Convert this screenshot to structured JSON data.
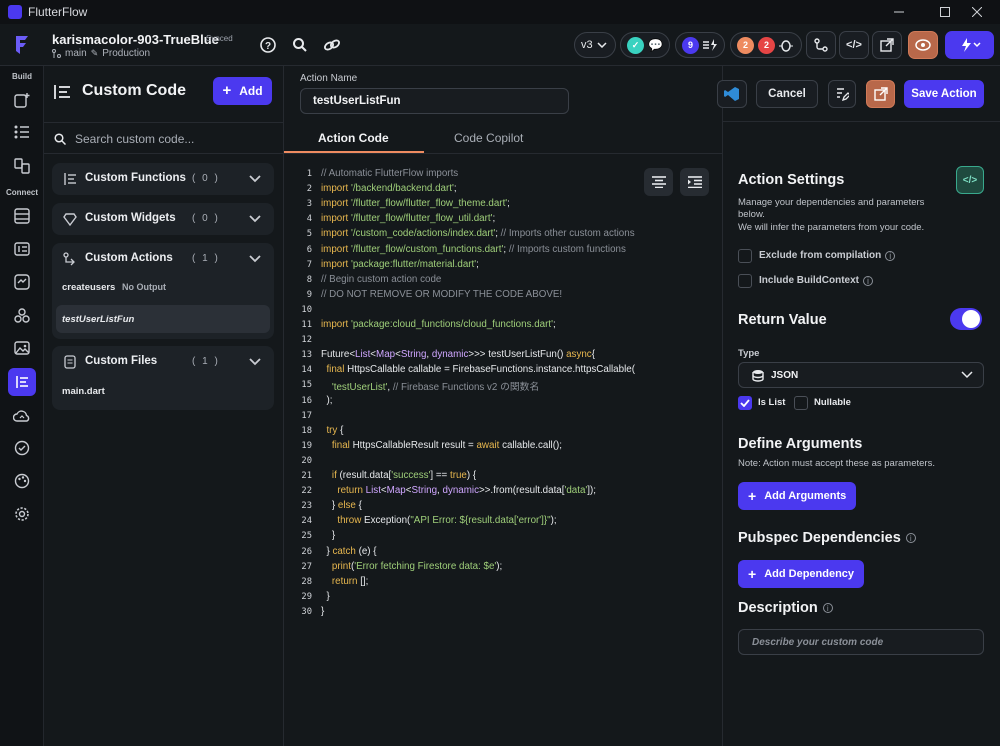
{
  "window": {
    "title": "FlutterFlow"
  },
  "header": {
    "project": "karismacolor-903-TrueBlue",
    "sync_status": "Synced",
    "branch": "main",
    "environment": "Production",
    "version": "v3",
    "badge_purple": "9",
    "badge_orange": "2",
    "badge_red": "2"
  },
  "rail": {
    "build_label": "Build",
    "connect_label": "Connect"
  },
  "left": {
    "title": "Custom Code",
    "add_label": "Add",
    "search_placeholder": "Search custom code...",
    "sections": [
      {
        "label": "Custom Functions",
        "count": "( 0 )"
      },
      {
        "label": "Custom Widgets",
        "count": "( 0 )"
      },
      {
        "label": "Custom Actions",
        "count": "( 1 )"
      },
      {
        "label": "Custom Files",
        "count": "( 1 )"
      }
    ],
    "actions": [
      {
        "name": "createusers",
        "note": "No Output"
      },
      {
        "name": "testUserListFun"
      }
    ],
    "files": [
      "main.dart"
    ]
  },
  "editor": {
    "action_name_label": "Action Name",
    "action_name": "testUserListFun",
    "tabs": [
      "Action Code",
      "Code Copilot"
    ],
    "lines": [
      [
        [
          "c-com",
          "// Automatic FlutterFlow imports"
        ]
      ],
      [
        [
          "c-kw",
          "import "
        ],
        [
          "c-str",
          "'/backend/backend.dart'"
        ],
        [
          "",
          "; "
        ]
      ],
      [
        [
          "c-kw",
          "import "
        ],
        [
          "c-str",
          "'/flutter_flow/flutter_flow_theme.dart'"
        ],
        [
          "",
          ";"
        ]
      ],
      [
        [
          "c-kw",
          "import "
        ],
        [
          "c-str",
          "'/flutter_flow/flutter_flow_util.dart'"
        ],
        [
          "",
          ";"
        ]
      ],
      [
        [
          "c-kw",
          "import "
        ],
        [
          "c-str",
          "'/custom_code/actions/index.dart'"
        ],
        [
          "",
          "; "
        ],
        [
          "c-com",
          "// Imports other custom actions"
        ]
      ],
      [
        [
          "c-kw",
          "import "
        ],
        [
          "c-str",
          "'/flutter_flow/custom_functions.dart'"
        ],
        [
          "",
          "; "
        ],
        [
          "c-com",
          "// Imports custom functions"
        ]
      ],
      [
        [
          "c-kw",
          "import "
        ],
        [
          "c-str",
          "'package:flutter/material.dart'"
        ],
        [
          "",
          ";"
        ]
      ],
      [
        [
          "c-com",
          "// Begin custom action code"
        ]
      ],
      [
        [
          "c-com",
          "// DO NOT REMOVE OR MODIFY THE CODE ABOVE!"
        ]
      ],
      [
        [
          "",
          ""
        ]
      ],
      [
        [
          "c-kw",
          "import "
        ],
        [
          "c-str",
          "'package:cloud_functions/cloud_functions.dart'"
        ],
        [
          "",
          ";"
        ]
      ],
      [
        [
          "",
          ""
        ]
      ],
      [
        [
          "",
          "Future<"
        ],
        [
          "c-ty",
          "List"
        ],
        [
          "",
          "<"
        ],
        [
          "c-ty",
          "Map"
        ],
        [
          "",
          "<"
        ],
        [
          "c-ty",
          "String"
        ],
        [
          "",
          ", "
        ],
        [
          "c-ty",
          "dynamic"
        ],
        [
          "",
          ">>> testUserListFun() "
        ],
        [
          "c-kw",
          "async"
        ],
        [
          "",
          ""
        ],
        [
          "",
          "{"
        ]
      ],
      [
        [
          "",
          "  "
        ],
        [
          "c-kw",
          "final"
        ],
        [
          "",
          " HttpsCallable callable = FirebaseFunctions.instance.httpsCallable("
        ]
      ],
      [
        [
          "",
          "    "
        ],
        [
          "c-str",
          "'testUserList'"
        ],
        [
          "",
          ", "
        ],
        [
          "c-com",
          "// Firebase Functions v2 の関数名"
        ]
      ],
      [
        [
          "",
          "  );"
        ]
      ],
      [
        [
          "",
          ""
        ]
      ],
      [
        [
          "",
          "  "
        ],
        [
          "c-kw",
          "try"
        ],
        [
          "",
          " {"
        ]
      ],
      [
        [
          "",
          "    "
        ],
        [
          "c-kw",
          "final"
        ],
        [
          "",
          " HttpsCallableResult result = "
        ],
        [
          "c-kw",
          "await"
        ],
        [
          "",
          " callable.call();"
        ]
      ],
      [
        [
          "",
          ""
        ]
      ],
      [
        [
          "",
          "    "
        ],
        [
          "c-kw",
          "if"
        ],
        [
          "",
          " (result.data["
        ],
        [
          "c-str",
          "'success'"
        ],
        [
          "",
          "] == "
        ],
        [
          "c-kw",
          "true"
        ],
        [
          "",
          ") {"
        ]
      ],
      [
        [
          "",
          "      "
        ],
        [
          "c-kw",
          "return"
        ],
        [
          "",
          " "
        ],
        [
          "c-ty",
          "List"
        ],
        [
          "",
          "<"
        ],
        [
          "c-ty",
          "Map"
        ],
        [
          "",
          "<"
        ],
        [
          "c-ty",
          "String"
        ],
        [
          "",
          ", "
        ],
        [
          "c-ty",
          "dynamic"
        ],
        [
          "",
          ">>.from(result.data["
        ],
        [
          "c-str",
          "'data'"
        ],
        [
          "",
          "]);"
        ]
      ],
      [
        [
          "",
          "    } "
        ],
        [
          "c-kw",
          "else"
        ],
        [
          "",
          " {"
        ]
      ],
      [
        [
          "",
          "      "
        ],
        [
          "c-kw",
          "throw"
        ],
        [
          "",
          " Exception("
        ],
        [
          "c-str",
          "\"API Error: ${result.data['error']}\""
        ],
        [
          "",
          ");"
        ]
      ],
      [
        [
          "",
          "    }"
        ]
      ],
      [
        [
          "",
          "  } "
        ],
        [
          "c-kw",
          "catch"
        ],
        [
          "",
          " (e) {"
        ]
      ],
      [
        [
          "",
          "    "
        ],
        [
          "c-kw",
          "print"
        ],
        [
          "",
          "("
        ],
        [
          "c-str",
          "'Error fetching Firestore data: $e'"
        ],
        [
          "",
          ");"
        ]
      ],
      [
        [
          "",
          "    "
        ],
        [
          "c-kw",
          "return"
        ],
        [
          "",
          " [];"
        ]
      ],
      [
        [
          "",
          "  }"
        ]
      ],
      [
        [
          "",
          "}"
        ]
      ]
    ]
  },
  "right": {
    "cancel_label": "Cancel",
    "save_label": "Save Action",
    "settings_title": "Action Settings",
    "settings_desc_1": "Manage your dependencies and parameters",
    "settings_desc_2": "below.",
    "settings_desc_3": "We will infer the parameters from your code.",
    "exclude_label": "Exclude from compilation",
    "context_label": "Include BuildContext",
    "return_title": "Return Value",
    "type_label": "Type",
    "type_value": "JSON",
    "islist_label": "Is List",
    "nullable_label": "Nullable",
    "args_title": "Define Arguments",
    "args_note": "Note: Action must accept these as parameters.",
    "add_args_label": "Add Arguments",
    "pubspec_title": "Pubspec Dependencies",
    "add_dep_label": "Add Dependency",
    "desc_title": "Description",
    "desc_placeholder": "Describe your custom code"
  },
  "colors": {
    "accent": "#4b39ef",
    "green": "#39d2c0",
    "orange": "#ee8b60",
    "red": "#e64545"
  }
}
